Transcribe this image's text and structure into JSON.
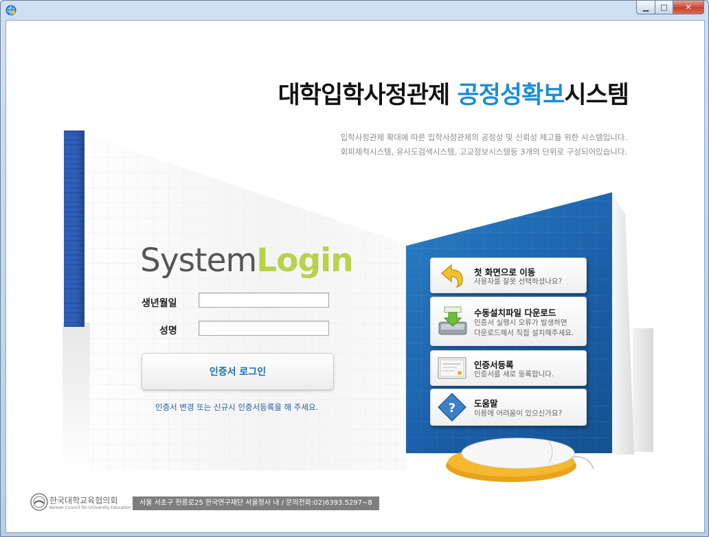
{
  "window": {
    "controls": {
      "minimize": "▁",
      "maximize": "□",
      "close": "✕"
    }
  },
  "header": {
    "title_main": "대학입학사정관제 ",
    "title_accent": "공정성확보",
    "title_tail": "시스템",
    "accent_color": "#1b8ed6",
    "desc_line1": "입학사정관제 확대에 따른 입학사정관제의 공정성 및 신뢰성 제고를 위한 시스템입니다.",
    "desc_line2": "회피제척시스템, 유사도검색시스템, 고교정보시스템등 3개의 단위로 구성되어있습니다."
  },
  "login": {
    "logo_part1": "System",
    "logo_part2": "Login",
    "birth_label": "생년월일",
    "birth_value": "",
    "name_label": "성명",
    "name_value": "",
    "button_label": "인증서 로그인",
    "notice": "인증서 변경 또는 신규시 인증서등록을 해 주세요."
  },
  "menu": [
    {
      "title": "첫 화면으로 이동",
      "desc1": "사용자를 잘못 선택하셨나요?",
      "desc2": "",
      "icon": "back-arrow-icon"
    },
    {
      "title": "수동설치파일 다운로드",
      "desc1": "인증서 실행시 오류가 발생하면",
      "desc2": "다운로드해서 직접 설치해주세요.",
      "icon": "download-drive-icon"
    },
    {
      "title": "인증서등록",
      "desc1": "인증서를 새로 등록합니다.",
      "desc2": "",
      "icon": "certificate-icon"
    },
    {
      "title": "도움말",
      "desc1": "이용에 어려움이 있으신가요?",
      "desc2": "",
      "icon": "help-icon"
    }
  ],
  "footer": {
    "org_korean": "한국대학교육협의회",
    "org_english": "Korean Council for University Education",
    "address": "서울 서초구 헌릉로25 한국연구재단 서울청사 내  /  문의전화:02)6393.5297~8"
  }
}
